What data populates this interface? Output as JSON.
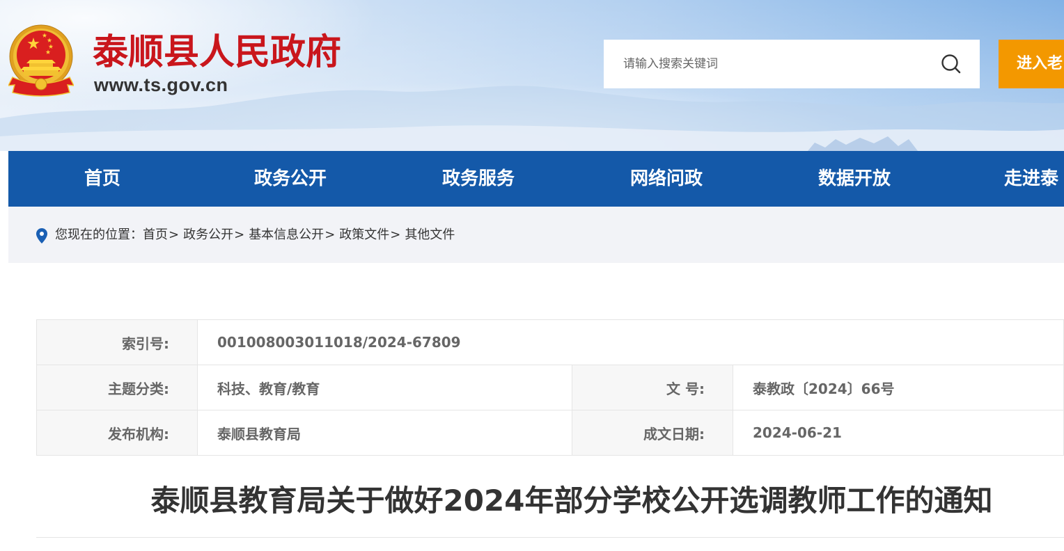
{
  "theme": {
    "brand_red": "#c9161c",
    "nav_blue": "#1459a9",
    "accent_orange": "#f39800",
    "pin_blue": "#1a5fb4"
  },
  "header": {
    "emblem_icon": "national-emblem-icon",
    "site_title": "泰顺县人民政府",
    "site_url": "www.ts.gov.cn",
    "search": {
      "placeholder": "请输入搜索关键词",
      "icon": "search-icon"
    },
    "elder_mode_button": "进入老"
  },
  "nav": {
    "items": [
      "首页",
      "政务公开",
      "政务服务",
      "网络问政",
      "数据开放",
      "走进泰"
    ]
  },
  "breadcrumb": {
    "icon": "location-pin-icon",
    "prefix": "您现在的位置：",
    "separator": ">",
    "items": [
      "首页",
      "政务公开",
      "基本信息公开",
      "政策文件",
      "其他文件"
    ]
  },
  "meta_table": {
    "index_no": {
      "label": "索引号:",
      "value": "001008003011018/2024-67809"
    },
    "topic": {
      "label": "主题分类:",
      "value": "科技、教育/教育"
    },
    "doc_no": {
      "label": "文 号:",
      "value": "泰教政〔2024〕66号"
    },
    "publisher": {
      "label": "发布机构:",
      "value": "泰顺县教育局"
    },
    "date": {
      "label": "成文日期:",
      "value": "2024-06-21"
    }
  },
  "article": {
    "title": "泰顺县教育局关于做好2024年部分学校公开选调教师工作的通知"
  }
}
